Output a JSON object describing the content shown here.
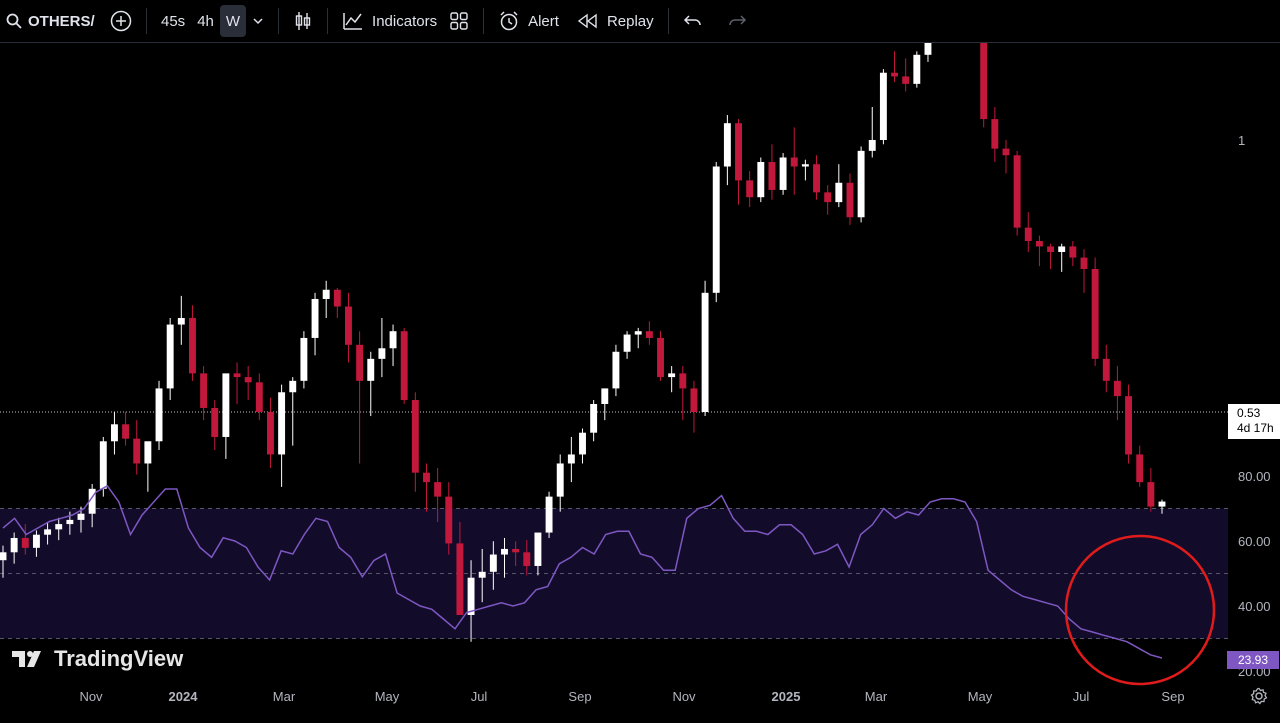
{
  "toolbar": {
    "symbol": "OTHERS/",
    "intervals": [
      "45s",
      "4h",
      "W"
    ],
    "active_interval": "W",
    "indicators_label": "Indicators",
    "alert_label": "Alert",
    "replay_label": "Replay"
  },
  "price_axis": {
    "top_label": "1",
    "current_price": "0.53",
    "countdown": "4d 17h"
  },
  "rsi_axis": {
    "labels": [
      "80.00",
      "60.00",
      "40.00",
      "20.00"
    ],
    "current_value": "23.93"
  },
  "time_axis": [
    "Nov",
    "2024",
    "Mar",
    "May",
    "Jul",
    "Sep",
    "Nov",
    "2025",
    "Mar",
    "May",
    "Jul",
    "Sep"
  ],
  "branding": {
    "text": "TradingView"
  },
  "colors": {
    "up": "#ffffff",
    "down": "#c2183c",
    "rsi_line": "#7e57c2",
    "rsi_band": "#120c2a",
    "circle": "#e01b1b"
  },
  "chart_data": {
    "type": "candlestick",
    "interval": "W",
    "ohlc": [
      [
        0.375,
        0.388,
        0.36,
        0.382
      ],
      [
        0.382,
        0.4,
        0.372,
        0.395
      ],
      [
        0.395,
        0.408,
        0.38,
        0.386
      ],
      [
        0.386,
        0.402,
        0.378,
        0.398
      ],
      [
        0.398,
        0.41,
        0.389,
        0.403
      ],
      [
        0.403,
        0.414,
        0.393,
        0.408
      ],
      [
        0.408,
        0.42,
        0.398,
        0.412
      ],
      [
        0.412,
        0.425,
        0.4,
        0.418
      ],
      [
        0.418,
        0.448,
        0.405,
        0.443
      ],
      [
        0.443,
        0.5,
        0.435,
        0.495
      ],
      [
        0.495,
        0.53,
        0.48,
        0.515
      ],
      [
        0.515,
        0.53,
        0.49,
        0.498
      ],
      [
        0.498,
        0.52,
        0.458,
        0.47
      ],
      [
        0.47,
        0.49,
        0.44,
        0.495
      ],
      [
        0.495,
        0.57,
        0.485,
        0.56
      ],
      [
        0.56,
        0.66,
        0.545,
        0.65
      ],
      [
        0.65,
        0.695,
        0.62,
        0.66
      ],
      [
        0.66,
        0.68,
        0.57,
        0.58
      ],
      [
        0.58,
        0.59,
        0.52,
        0.535
      ],
      [
        0.535,
        0.545,
        0.485,
        0.5
      ],
      [
        0.5,
        0.555,
        0.475,
        0.58
      ],
      [
        0.58,
        0.595,
        0.54,
        0.575
      ],
      [
        0.575,
        0.59,
        0.545,
        0.568
      ],
      [
        0.568,
        0.58,
        0.52,
        0.53
      ],
      [
        0.53,
        0.548,
        0.465,
        0.48
      ],
      [
        0.48,
        0.565,
        0.445,
        0.555
      ],
      [
        0.555,
        0.575,
        0.49,
        0.57
      ],
      [
        0.57,
        0.64,
        0.56,
        0.63
      ],
      [
        0.63,
        0.7,
        0.605,
        0.69
      ],
      [
        0.69,
        0.72,
        0.66,
        0.705
      ],
      [
        0.705,
        0.708,
        0.66,
        0.678
      ],
      [
        0.678,
        0.7,
        0.595,
        0.62
      ],
      [
        0.62,
        0.64,
        0.47,
        0.57
      ],
      [
        0.57,
        0.61,
        0.525,
        0.6
      ],
      [
        0.6,
        0.66,
        0.575,
        0.615
      ],
      [
        0.615,
        0.65,
        0.59,
        0.64
      ],
      [
        0.64,
        0.645,
        0.54,
        0.545
      ],
      [
        0.545,
        0.555,
        0.44,
        0.46
      ],
      [
        0.46,
        0.47,
        0.42,
        0.45
      ],
      [
        0.45,
        0.465,
        0.41,
        0.435
      ],
      [
        0.435,
        0.45,
        0.38,
        0.39
      ],
      [
        0.39,
        0.41,
        0.33,
        0.33
      ],
      [
        0.33,
        0.375,
        0.31,
        0.36
      ],
      [
        0.36,
        0.385,
        0.34,
        0.365
      ],
      [
        0.365,
        0.392,
        0.35,
        0.38
      ],
      [
        0.38,
        0.395,
        0.36,
        0.385
      ],
      [
        0.385,
        0.392,
        0.37,
        0.382
      ],
      [
        0.382,
        0.393,
        0.362,
        0.37
      ],
      [
        0.37,
        0.398,
        0.362,
        0.4
      ],
      [
        0.4,
        0.44,
        0.395,
        0.435
      ],
      [
        0.435,
        0.48,
        0.42,
        0.47
      ],
      [
        0.47,
        0.5,
        0.45,
        0.48
      ],
      [
        0.48,
        0.51,
        0.47,
        0.505
      ],
      [
        0.505,
        0.545,
        0.495,
        0.54
      ],
      [
        0.54,
        0.56,
        0.52,
        0.56
      ],
      [
        0.56,
        0.62,
        0.55,
        0.61
      ],
      [
        0.61,
        0.64,
        0.6,
        0.635
      ],
      [
        0.635,
        0.645,
        0.615,
        0.64
      ],
      [
        0.64,
        0.655,
        0.62,
        0.63
      ],
      [
        0.63,
        0.64,
        0.57,
        0.575
      ],
      [
        0.575,
        0.59,
        0.555,
        0.58
      ],
      [
        0.58,
        0.59,
        0.52,
        0.56
      ],
      [
        0.56,
        0.57,
        0.505,
        0.53
      ],
      [
        0.53,
        0.72,
        0.525,
        0.7
      ],
      [
        0.7,
        0.95,
        0.685,
        0.94
      ],
      [
        0.94,
        1.06,
        0.9,
        1.04
      ],
      [
        1.04,
        1.05,
        0.86,
        0.91
      ],
      [
        0.91,
        0.93,
        0.855,
        0.875
      ],
      [
        0.875,
        0.96,
        0.865,
        0.95
      ],
      [
        0.95,
        0.99,
        0.87,
        0.89
      ],
      [
        0.89,
        0.97,
        0.88,
        0.96
      ],
      [
        0.96,
        1.03,
        0.88,
        0.94
      ],
      [
        0.94,
        0.955,
        0.91,
        0.945
      ],
      [
        0.945,
        0.965,
        0.87,
        0.885
      ],
      [
        0.885,
        0.9,
        0.84,
        0.865
      ],
      [
        0.865,
        0.945,
        0.855,
        0.905
      ],
      [
        0.905,
        0.925,
        0.82,
        0.835
      ],
      [
        0.835,
        0.985,
        0.825,
        0.975
      ],
      [
        0.975,
        1.08,
        0.96,
        1.0
      ],
      [
        1.0,
        1.18,
        0.99,
        1.17
      ],
      [
        1.17,
        1.23,
        1.145,
        1.16
      ],
      [
        1.16,
        1.21,
        1.12,
        1.14
      ],
      [
        1.14,
        1.23,
        1.13,
        1.22
      ],
      [
        1.22,
        1.34,
        1.2,
        1.32
      ],
      [
        1.32,
        1.36,
        1.3,
        1.345
      ],
      [
        1.345,
        1.36,
        1.31,
        1.33
      ],
      [
        1.33,
        1.36,
        1.29,
        1.31
      ],
      [
        1.31,
        1.34,
        1.28,
        1.3
      ],
      [
        1.3,
        1.32,
        1.03,
        1.05
      ],
      [
        1.05,
        1.08,
        0.95,
        0.98
      ],
      [
        0.98,
        1.0,
        0.925,
        0.965
      ],
      [
        0.965,
        0.975,
        0.8,
        0.815
      ],
      [
        0.815,
        0.845,
        0.77,
        0.79
      ],
      [
        0.79,
        0.8,
        0.745,
        0.78
      ],
      [
        0.78,
        0.785,
        0.74,
        0.77
      ],
      [
        0.77,
        0.785,
        0.735,
        0.78
      ],
      [
        0.78,
        0.79,
        0.745,
        0.76
      ],
      [
        0.76,
        0.775,
        0.7,
        0.74
      ],
      [
        0.74,
        0.76,
        0.59,
        0.6
      ],
      [
        0.6,
        0.62,
        0.555,
        0.57
      ],
      [
        0.57,
        0.59,
        0.52,
        0.55
      ],
      [
        0.55,
        0.565,
        0.47,
        0.48
      ],
      [
        0.48,
        0.49,
        0.445,
        0.45
      ],
      [
        0.45,
        0.465,
        0.42,
        0.425
      ],
      [
        0.425,
        0.432,
        0.418,
        0.43
      ]
    ],
    "price_label": "0.53",
    "rsi": {
      "values": [
        64,
        67,
        62,
        64,
        66,
        67,
        68,
        70,
        75,
        77,
        72,
        62,
        68,
        72,
        76,
        76,
        64,
        58,
        55,
        61,
        60,
        58,
        52,
        48,
        57,
        56,
        62,
        67,
        66,
        58,
        55,
        49,
        54,
        56,
        44,
        42,
        40,
        39,
        36,
        33,
        38,
        39,
        40,
        41,
        40,
        41,
        45,
        46,
        53,
        55,
        58,
        56,
        62,
        63,
        63,
        56,
        55,
        51,
        51,
        67,
        70,
        71,
        74,
        67,
        63,
        63,
        62,
        65,
        65,
        62,
        56,
        57,
        59,
        52,
        62,
        65,
        70,
        67,
        69,
        68,
        72,
        73,
        73,
        72,
        66,
        51,
        48,
        45,
        43,
        42,
        41,
        40,
        36,
        33,
        32,
        31,
        30,
        29,
        27,
        25,
        24
      ],
      "levels": [
        70,
        50,
        30
      ],
      "ylim": [
        20,
        80
      ]
    }
  }
}
